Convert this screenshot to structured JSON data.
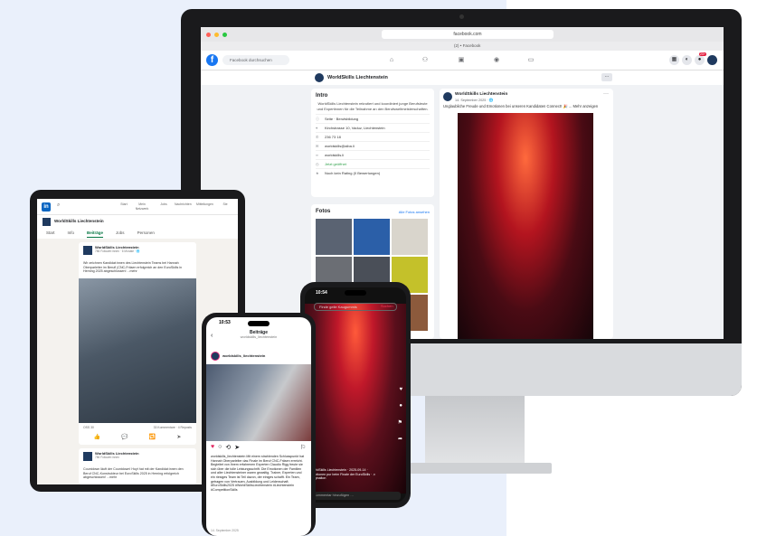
{
  "browser": {
    "url": "facebook.com",
    "tab_label": "(2) • Facebook",
    "colors": {
      "close": "#ff5f57",
      "min": "#febc2e",
      "max": "#28c840"
    }
  },
  "facebook": {
    "logo": "f",
    "search_placeholder": "Facebook durchsuchen",
    "nav_icons": [
      "home-icon",
      "friends-icon",
      "marketplace-icon",
      "groups-icon",
      "gaming-icon"
    ],
    "notification_badge": "20+",
    "page_name": "WorldSkills Liechtenstein",
    "more_label": "···",
    "intro": {
      "title": "Intro",
      "description": "WorldSkills Liechtenstein rekrutiert und koordiniert junge Berufsleute und Expertinnen für die Teilnahme an den Berufsweltmeisterschaften.",
      "rows": [
        {
          "icon": "info-icon",
          "text": "Seite · Berufsbildung"
        },
        {
          "icon": "pin-icon",
          "text": "Kirchstrasse 10, Vaduz, Liechtenstein"
        },
        {
          "icon": "phone-icon",
          "text": "236 73 18"
        },
        {
          "icon": "mail-icon",
          "text": "worldskills@aiba.li"
        },
        {
          "icon": "link-icon",
          "text": "worldskills.li"
        },
        {
          "icon": "clock-icon",
          "text": "Jetzt geöffnet"
        },
        {
          "icon": "star-icon",
          "text": "Noch kein Rating (0 Bewertungen)"
        }
      ]
    },
    "photos": {
      "title": "Fotos",
      "all_label": "Alle Fotos ansehen"
    },
    "post": {
      "author": "WorldSkills Liechtenstein",
      "date": "14. September 2025 · 🌐",
      "text": "Unglaubliche Freude und Emotionen bei unseren Kandidaten Connect! 🎉 ... Mehr anzeigen"
    }
  },
  "linkedin": {
    "logo": "in",
    "nav": [
      "Start",
      "Mein Netzwerk",
      "Jobs",
      "Nachrichten",
      "Mitteilungen",
      "Sie"
    ],
    "page_name": "WorldSkills Liechtenstein",
    "tabs": [
      "Start",
      "Info",
      "Beiträge",
      "Jobs",
      "Personen"
    ],
    "active_tab": "Beiträge",
    "post": {
      "author": "WorldSkills Liechtenstein",
      "meta": "786 Follower:innen · 6 Monate · 🌐",
      "text": "Wir zeichnen Kandidat:innen des Liechtenstein Teams bei Hannah Oberparleiter im Berufl (CNC-Fräsen erfolgreich an den EuroSkills in Herning 2025 abgeschlossen! ...mehr",
      "reactions": "OSS 30",
      "comments": "33 Kommentare · 4 Reposts",
      "actions": [
        "👍",
        "💬",
        "🔁",
        "➤"
      ]
    },
    "post2": {
      "author": "WorldSkills Liechtenstein",
      "meta": "786 Follower:innen",
      "text": "Countdown läuft der Countdown! Hoyt hat mit der Kandidat:innen den Beruf CNC-Konstrukteur bei EuroSkills 2025 in Herning erfolgreich abgeschlossen! ...mehr"
    }
  },
  "instagram": {
    "time": "10:53",
    "title": "Beiträge",
    "subtitle": "worldskills_liechtenstein",
    "username": "worldskills_liechtenstein",
    "text": "worldskills_liechtenstein Mit einem strahlenden Schlusspunkt hat Hannah Oberparleiter das Finale im Beruf CNC-Fräsen erreicht. Begleitet von ihrem erfahrenen Experten Claudio Rigg freute sie sich über die tolle Leistungsschrift. Die Emotionen der Familien und aller Liechtensteiner waren gewaltig. Trainer, Experten und ein riesiges Team ist Teil davon, der einiges schafft. Ein Team, getragen von Vertrauen, Ausbildung und Leidenschaft. #EuroSkills2025 #WorldSkillsLiechtenstein #Liechtenstein #CompetitionSkills",
    "date": "14. September 2025"
  },
  "tiktok": {
    "time": "10:54",
    "search_placeholder": "Finde geile Kaugummis",
    "search_button": "Suchen",
    "caption": "WorldSkills Liechtenstein · 2025-09-14 · Emotionen pur beim Finale der EuroSkills · ♬ Originalton",
    "comment_placeholder": "Kommentar hinzufügen …"
  }
}
